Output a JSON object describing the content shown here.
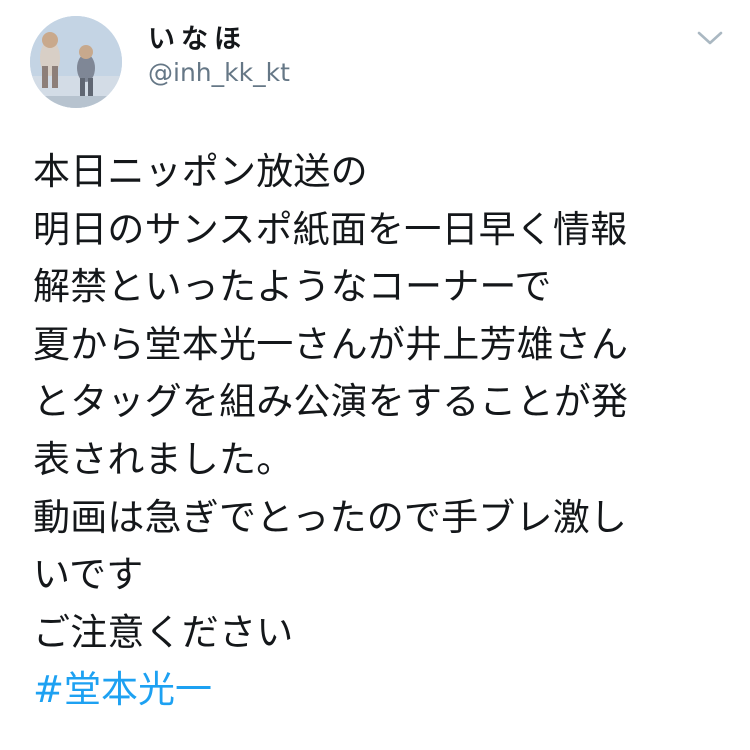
{
  "author": {
    "display_name": "いなほ",
    "handle": "@inh_kk_kt",
    "avatar_icon": "profile-photo-avatar"
  },
  "menu": {
    "icon": "chevron-down-icon"
  },
  "tweet": {
    "lines": [
      "本日ニッポン放送の",
      "明日のサンスポ紙面を一日早く情報",
      "解禁といったようなコーナーで",
      "夏から堂本光一さんが井上芳雄さん",
      "とタッグを組み公演をすることが発",
      "表されました。",
      "動画は急ぎでとったので手ブレ激し",
      "いです",
      "ご注意ください"
    ],
    "hashtag": "#堂本光一"
  },
  "colors": {
    "text": "#14171a",
    "secondary": "#657786",
    "link": "#1da1f2",
    "caret": "#aab8c2"
  }
}
